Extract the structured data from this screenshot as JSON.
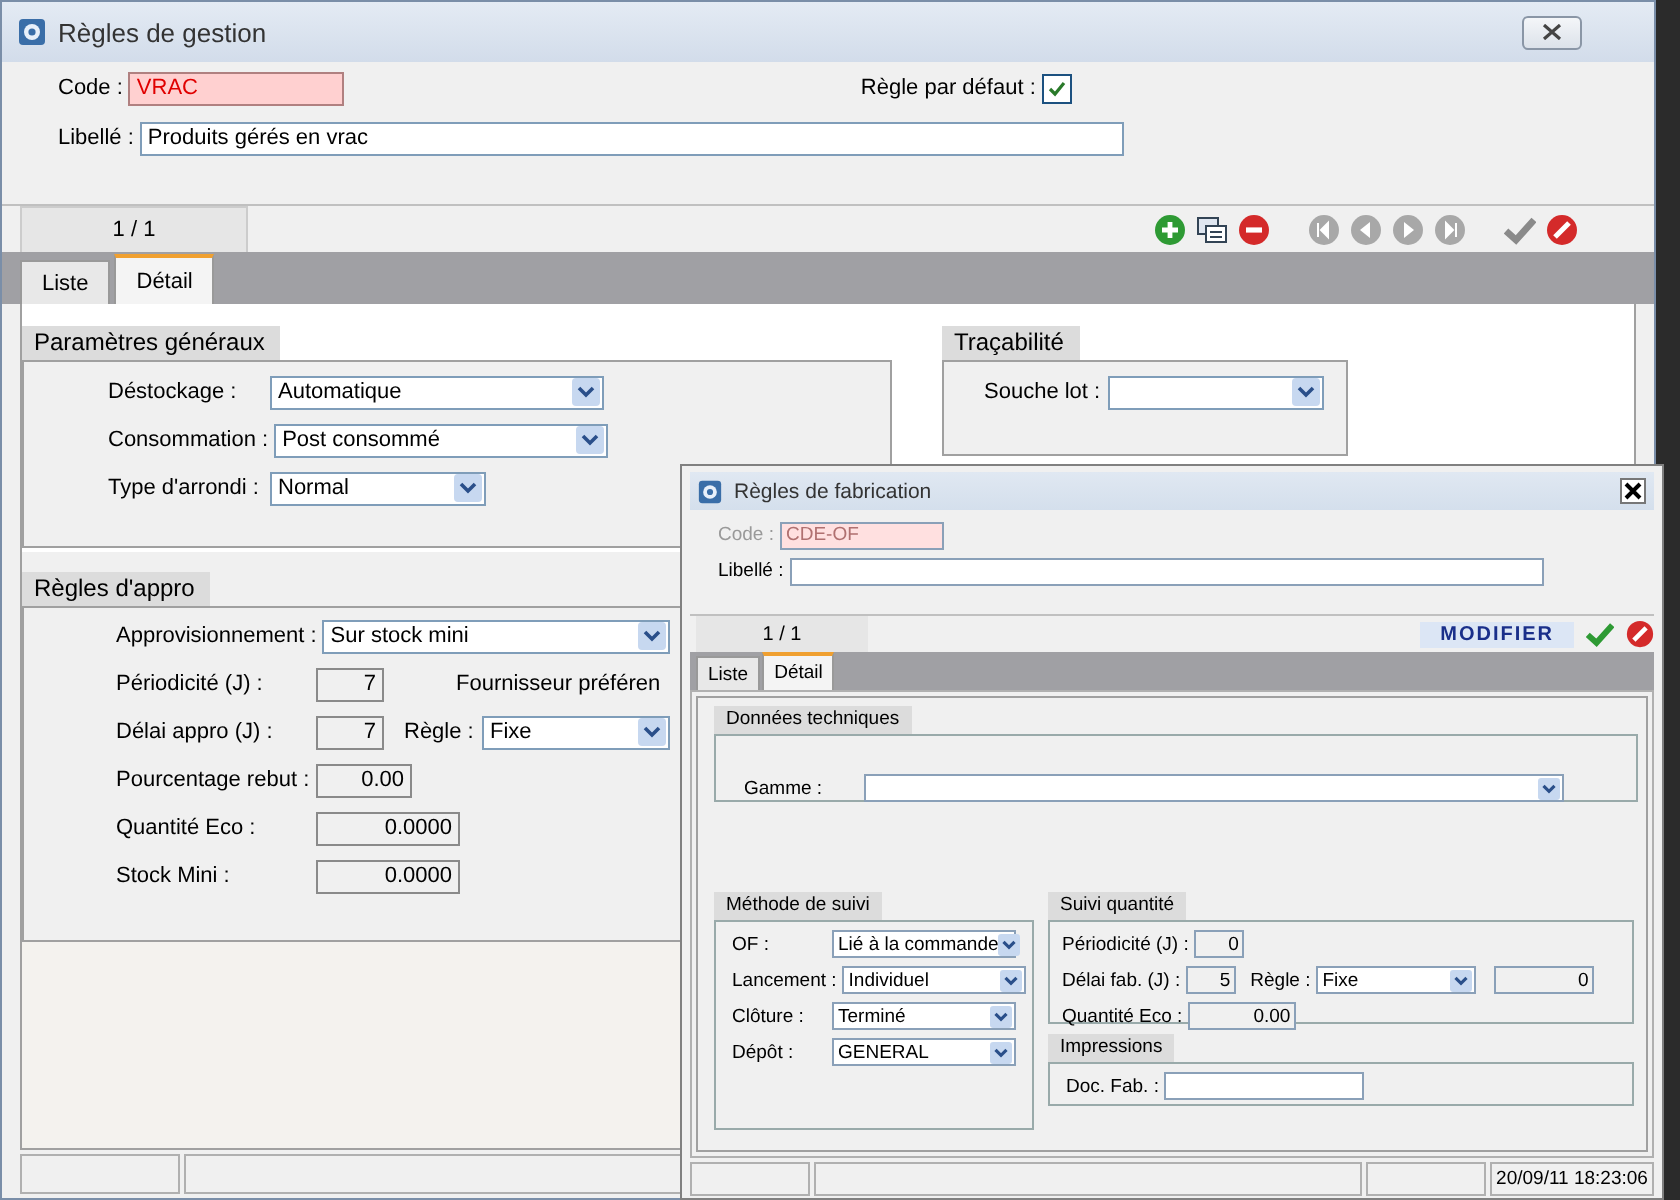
{
  "main_window": {
    "title": "Règles de gestion",
    "code": {
      "label": "Code :",
      "value": "VRAC",
      "disabled": false
    },
    "default_rule": {
      "label": "Règle par défaut :",
      "checked": true
    },
    "libelle": {
      "label": "Libellé :",
      "value": "Produits gérés en vrac"
    },
    "record_counter": "1 / 1",
    "tabs": [
      {
        "label": "Liste",
        "selected": false
      },
      {
        "label": "Détail",
        "selected": true
      }
    ],
    "general": {
      "title": "Paramètres généraux",
      "fields": [
        {
          "label": "Déstockage :",
          "value": "Automatique",
          "kind": "select"
        },
        {
          "label": "Consommation :",
          "value": "Post consommé",
          "kind": "select"
        },
        {
          "label": "Type d'arrondi :",
          "value": "Normal",
          "kind": "short_select"
        }
      ]
    },
    "traceability": {
      "title": "Traçabilité",
      "fields": [
        {
          "label": "Souche lot :",
          "kind": "select"
        }
      ]
    },
    "supply": {
      "title": "Règles d'appro",
      "fields": [
        {
          "label": "Approvisionnement :",
          "value": "Sur stock mini",
          "kind": "select"
        },
        {
          "label": "Périodicité (J) :",
          "value": "7",
          "kind": "integer",
          "extra": {
            "label": "Fournisseur préféren"
          }
        },
        {
          "label": "Délai appro (J) :",
          "value": "7",
          "kind": "integer",
          "extra": {
            "label": "Règle :",
            "value": "Fixe",
            "kind": "select"
          }
        },
        {
          "label": "Pourcentage rebut :",
          "value": "0.00",
          "kind": "decimal"
        },
        {
          "label": "Quantité Eco :",
          "value": "0.0000",
          "kind": "quantity"
        },
        {
          "label": "Stock Mini :",
          "value": "0.0000",
          "kind": "quantity"
        }
      ]
    }
  },
  "dialog": {
    "title": "Règles de fabrication",
    "code": {
      "label": "Code :",
      "value": "CDE-OF",
      "disabled": true
    },
    "libelle": {
      "label": "Libellé :"
    },
    "record_counter": "1 / 1",
    "mode": "MODIFIER",
    "tabs": [
      {
        "label": "Liste",
        "selected": false
      },
      {
        "label": "Détail",
        "selected": true
      }
    ],
    "technical": {
      "title": "Données techniques",
      "fields": [
        {
          "label": "Gamme :",
          "kind": "select"
        }
      ]
    },
    "tracking": {
      "title": "Méthode de suivi",
      "fields": [
        {
          "label": "OF :",
          "value": "Lié à la commande",
          "kind": "select"
        },
        {
          "label": "Lancement :",
          "value": "Individuel",
          "kind": "select"
        },
        {
          "label": "Clôture :",
          "value": "Terminé",
          "kind": "select"
        },
        {
          "label": "Dépôt :",
          "value": "GENERAL",
          "kind": "select"
        }
      ]
    },
    "quantity": {
      "title": "Suivi quantité",
      "fields": [
        {
          "label": "Périodicité (J) :",
          "value": "0",
          "kind": "integer"
        },
        {
          "label": "Délai fab. (J) :",
          "value": "5",
          "kind": "integer",
          "extra": {
            "label": "Règle :",
            "value": "Fixe",
            "kind": "select",
            "value2": "0"
          }
        },
        {
          "label": "Quantité Eco :",
          "value": "0.00",
          "kind": "decimal"
        }
      ]
    },
    "printing": {
      "title": "Impressions",
      "fields": [
        {
          "label": "Doc. Fab. :",
          "kind": "text"
        }
      ]
    },
    "timestamp": "20/09/11 18:23:06"
  }
}
